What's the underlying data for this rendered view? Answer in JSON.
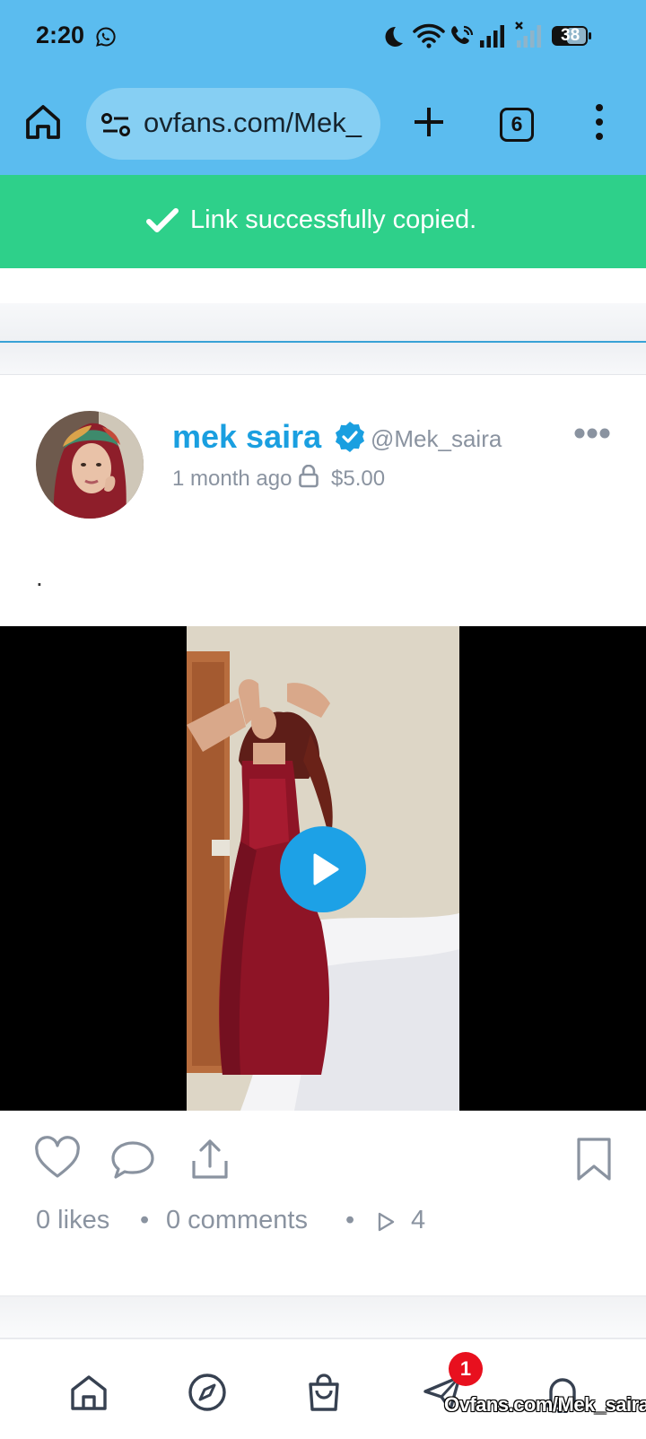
{
  "status_bar": {
    "time": "2:20",
    "battery": "38",
    "icons": [
      "whatsapp-icon",
      "do-not-disturb-icon",
      "wifi-icon",
      "wifi-calling-icon",
      "signal-icon",
      "signal-no-service-icon",
      "battery-icon"
    ]
  },
  "browser": {
    "url": "ovfans.com/Mek_",
    "tab_count": "6",
    "icons": [
      "home-icon",
      "site-info-icon",
      "new-tab-icon",
      "tabs-icon",
      "menu-icon"
    ]
  },
  "toast": {
    "message": "Link successfully copied."
  },
  "post": {
    "author_name": "mek saira",
    "handle": "@Mek_saira",
    "time_ago": "1 month ago",
    "price": "$5.00",
    "text": ".",
    "likes": "0 likes",
    "comments": "0 comments",
    "views": "4"
  },
  "bottom_nav": {
    "items": [
      "home",
      "explore",
      "shop",
      "messages",
      "notifications"
    ],
    "messages_badge": "1",
    "watermark": "Ovfans.com/Mek_saira"
  },
  "colors": {
    "chrome": "#5bbcef",
    "toast": "#2ed08a",
    "accent": "#1a9fe0",
    "badge": "#e8101e"
  }
}
